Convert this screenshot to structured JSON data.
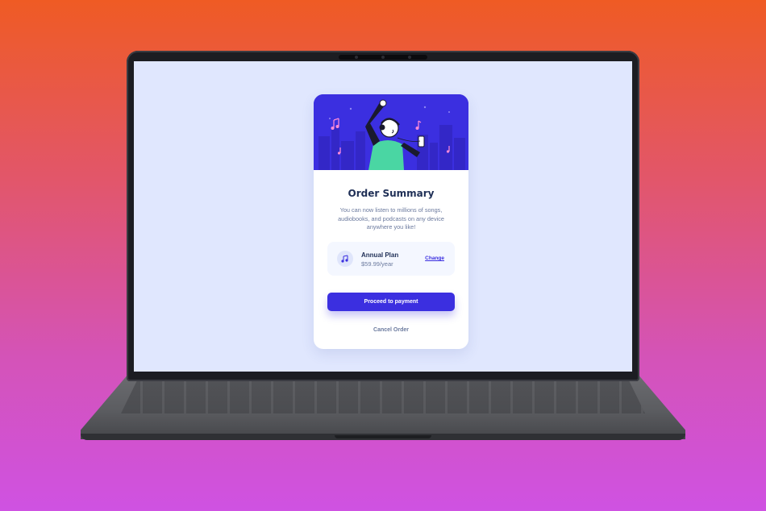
{
  "card": {
    "title": "Order Summary",
    "description": "You can now listen to millions of songs, audiobooks, and podcasts on any device anywhere you like!",
    "plan": {
      "name": "Annual Plan",
      "price": "$59.99/year",
      "change_label": "Change",
      "icon": "music-note-icon"
    },
    "primary_button": "Proceed to payment",
    "secondary_button": "Cancel Order"
  },
  "colors": {
    "accent": "#3b2fe0",
    "screen_bg": "#e0e7fe",
    "title": "#1f2f56",
    "muted": "#6b7a9e"
  }
}
